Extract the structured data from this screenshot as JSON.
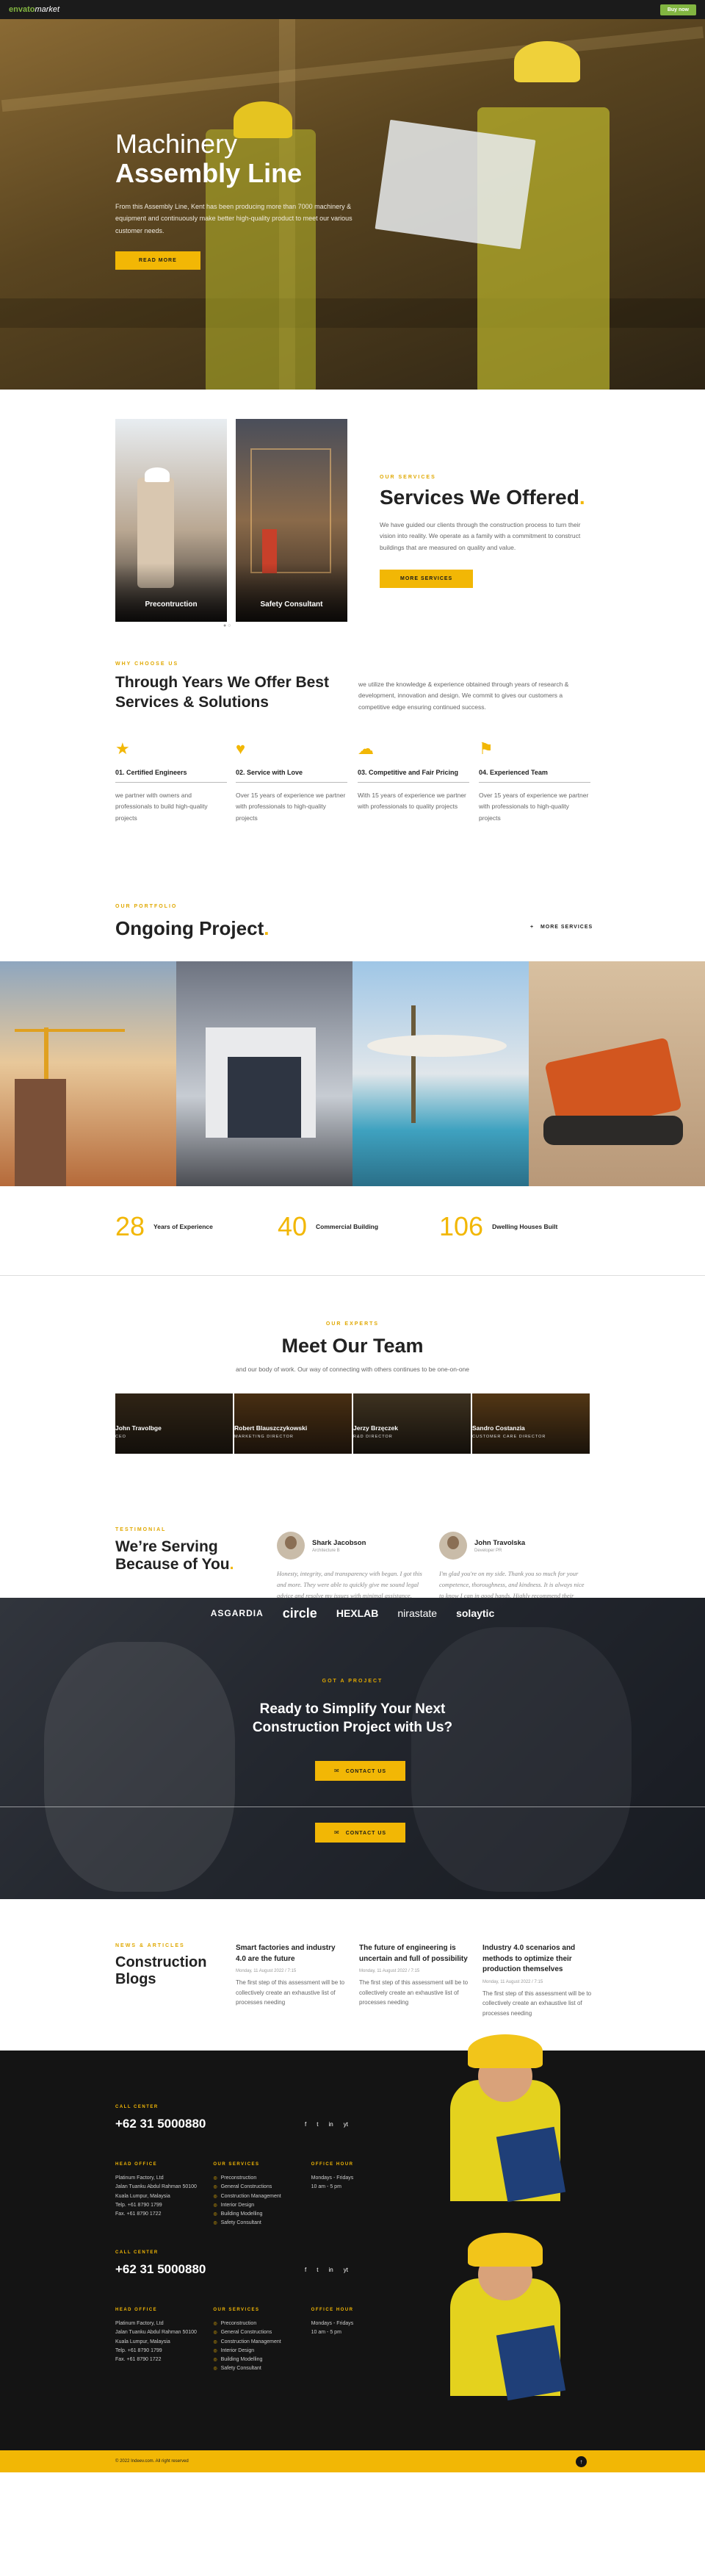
{
  "topbar": {
    "logo_brand": "envato",
    "logo_market": "market",
    "buy_now": "Buy now"
  },
  "hero": {
    "title_line1": "Machinery",
    "title_line2": "Assembly Line",
    "description": "From this Assembly Line, Kent has been producing more than 7000 machinery & equipment and continuously make better high-quality product to meet our various customer needs.",
    "button": "Read More"
  },
  "services": {
    "cards": [
      "Precontruction",
      "Safety Consultant"
    ],
    "tag": "Our Services",
    "title": "Services We Offered",
    "title_dot": ".",
    "description": "We have guided our clients through the construction process to turn their vision into reality. We operate as a family with a commitment to construct buildings that are measured on quality and value.",
    "button": "More Services"
  },
  "why": {
    "tag": "Why Choose Us",
    "title": "Through Years We Offer Best Services & Solutions",
    "description": "we utilize the knowledge & experience obtained through years of research & development, innovation and design. We commit to gives our customers a competitive edge ensuring continued success.",
    "features": [
      {
        "icon": "award-icon",
        "glyph": "★",
        "title": "01. Certified Engineers",
        "text": "we partner with owners and professionals to build high-quality projects"
      },
      {
        "icon": "heart-pulse-icon",
        "glyph": "♥",
        "title": "02. Service with Love",
        "text": "Over 15 years of experience we partner with professionals to high-quality projects"
      },
      {
        "icon": "coins-icon",
        "glyph": "☁",
        "title": "03. Competitive and Fair Pricing",
        "text": "With 15 years of experience we partner with professionals to quality projects"
      },
      {
        "icon": "badge-icon",
        "glyph": "⚑",
        "title": "04. Experienced Team",
        "text": "Over 15 years of experience we partner with professionals to high-quality projects"
      }
    ]
  },
  "project": {
    "tag": "Our Portfolio",
    "title": "Ongoing Project",
    "title_dot": ".",
    "more": "More Services"
  },
  "stats": [
    {
      "num": "28",
      "label": "Years of Experience"
    },
    {
      "num": "40",
      "label": "Commercial Building"
    },
    {
      "num": "106",
      "label": "Dwelling Houses Built"
    }
  ],
  "team": {
    "tag": "Our Experts",
    "title": "Meet Our Team",
    "subtitle": "and our body of work. Our way of connecting with others continues to be one-on-one",
    "members": [
      {
        "name": "John Travolbge",
        "role": "CEO"
      },
      {
        "name": "Robert Blauszczykowski",
        "role": "MARKETING DIRECTOR"
      },
      {
        "name": "Jerzy Brzęczek",
        "role": "R&D DIRECTOR"
      },
      {
        "name": "Sandro Costanzia",
        "role": "CUSTOMER CARE DIRECTOR"
      }
    ]
  },
  "testimonial": {
    "tag": "Testimonial",
    "title_line1": "We’re Serving",
    "title_line2": "Because of You",
    "title_dot": ".",
    "reviews": [
      {
        "name": "Shark Jacobson",
        "role": "Architecture B",
        "text": "Honesty, integrity, and transparency with began. I got this and more. They were able to quickly give me sound legal advice and resolve my issues with minimal assistance."
      },
      {
        "name": "John Travolska",
        "role": "Developer PR",
        "text": "I'm glad you're on my side. Thank you so much for your competence, thoroughness, and kindness. It is always nice to know I can in good hands. Highly recommend their services."
      }
    ]
  },
  "cta": {
    "brands": [
      "ASGARDIA",
      "circle",
      "HEXLAB",
      "nirastate",
      "solaytic"
    ],
    "tag": "Got a Project",
    "title_line1": "Ready to Simplify Your Next",
    "title_line2": "Construction Project with Us?",
    "button": "Contact Us"
  },
  "blogs": {
    "tag": "News & Articles",
    "title_line1": "Construction",
    "title_line2": "Blogs",
    "posts": [
      {
        "title": "Smart factories and industry 4.0 are the future",
        "date": "Monday, 11 August 2022 / 7:15",
        "excerpt": "The first step of this assessment will be to collectively create an exhaustive list of processes needing"
      },
      {
        "title": "The future of engineering is uncertain and full of possibility",
        "date": "Monday, 11 August 2022 / 7:15",
        "excerpt": "The first step of this assessment will be to collectively create an exhaustive list of processes needing"
      },
      {
        "title": "Industry 4.0 scenarios and methods to optimize their production themselves",
        "date": "Monday, 11 August 2022 / 7:15",
        "excerpt": "The first step of this assessment will be to collectively create an exhaustive list of processes needing"
      }
    ]
  },
  "footer": {
    "call_center": "Call Center",
    "phone": "+62 31 5000880",
    "social": [
      "f",
      "t",
      "in",
      "yt"
    ],
    "head_office": "Head Office",
    "address": [
      "Platinum Factory, Ltd",
      "Jalan Tuanku Abdul Rahman 50100",
      "Kuala Lumpur, Malaysia",
      "Telp. +61 8790 1799",
      "Fax. +61 8790 1722"
    ],
    "our_services": "Our Services",
    "services": [
      "Preconstruction",
      "General Constructions",
      "Construction Management",
      "Interior Design",
      "Building Modelling",
      "Safety Consultant"
    ],
    "office_hour": "Office Hour",
    "hours": [
      "Mondays - Fridays",
      "10 am - 5 pm"
    ],
    "copyright": "© 2022 Indeev.com. All right reserved"
  },
  "colors": {
    "accent": "#f2b705",
    "dark": "#141414",
    "envato_green": "#82b541"
  }
}
